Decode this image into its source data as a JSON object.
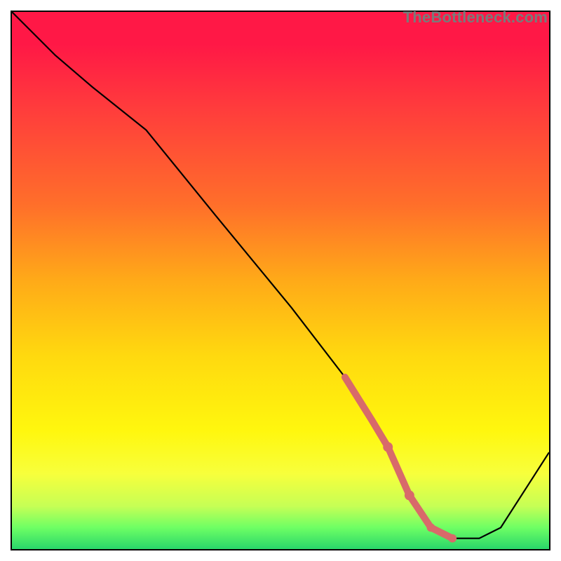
{
  "watermark": "TheBottleneck.com",
  "chart_data": {
    "type": "line",
    "title": "",
    "xlabel": "",
    "ylabel": "",
    "xlim": [
      0,
      100
    ],
    "ylim": [
      0,
      100
    ],
    "series": [
      {
        "name": "bottleneck-curve",
        "x": [
          0,
          8,
          15,
          25,
          38,
          52,
          62,
          67,
          70,
          74,
          78,
          82,
          87,
          91,
          100
        ],
        "values": [
          100,
          92,
          86,
          78,
          62,
          45,
          32,
          24,
          19,
          10,
          4,
          2,
          2,
          4,
          18
        ]
      }
    ],
    "highlight_segment": {
      "name": "highlighted-data-range",
      "color": "#d86a6a",
      "x": [
        62,
        67,
        70,
        74,
        78,
        82
      ],
      "values": [
        32,
        24,
        19,
        10,
        4,
        2
      ]
    },
    "highlight_dots": {
      "name": "highlighted-points",
      "color": "#d86a6a",
      "points": [
        {
          "x": 70,
          "y": 19
        },
        {
          "x": 74,
          "y": 10
        },
        {
          "x": 78,
          "y": 4
        },
        {
          "x": 82,
          "y": 2
        }
      ]
    }
  }
}
